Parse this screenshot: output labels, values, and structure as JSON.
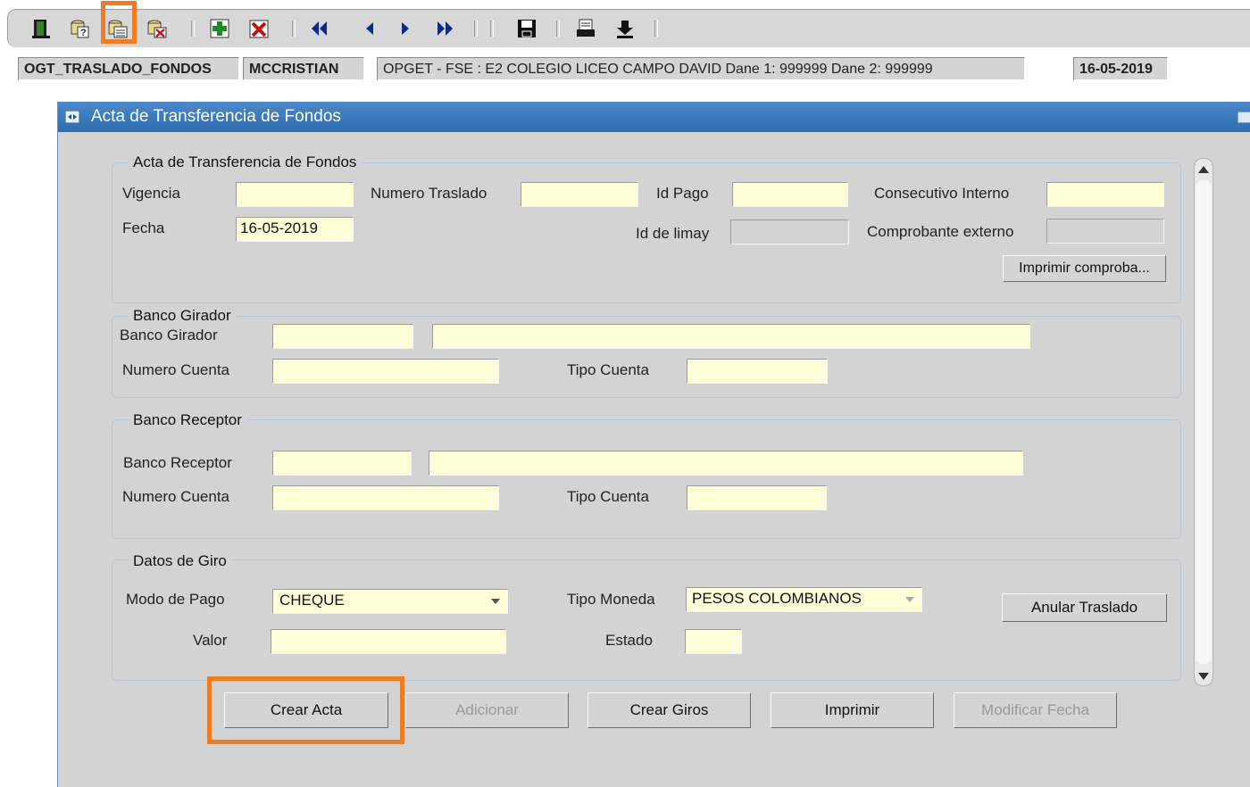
{
  "toolbar": {
    "buttons": [
      {
        "name": "exit-icon"
      },
      {
        "name": "query-icon"
      },
      {
        "name": "execute-query-icon"
      },
      {
        "name": "cancel-query-icon"
      },
      {
        "name": "insert-record-icon"
      },
      {
        "name": "delete-record-icon"
      },
      {
        "name": "first-record-icon"
      },
      {
        "name": "previous-record-icon"
      },
      {
        "name": "next-record-icon"
      },
      {
        "name": "last-record-icon"
      },
      {
        "name": "save-icon"
      },
      {
        "name": "print-icon"
      },
      {
        "name": "download-icon"
      }
    ],
    "highlight_color": "#f07c22"
  },
  "status_bar": {
    "module": "OGT_TRASLADO_FONDOS",
    "user": "MCCRISTIAN",
    "entity": "OPGET - FSE : E2 COLEGIO LICEO CAMPO DAVID  Dane 1: 999999  Dane 2: 999999",
    "date": "16-05-2019"
  },
  "window": {
    "title": "Acta de Transferencia de Fondos",
    "title_bar_color": "#3a78bd"
  },
  "acta": {
    "title": "Acta de Transferencia de Fondos",
    "vigencia_label": "Vigencia",
    "vigencia_value": "",
    "numero_traslado_label": "Numero Traslado",
    "numero_traslado_value": "",
    "id_pago_label": "Id Pago",
    "id_pago_value": "",
    "consecutivo_label": "Consecutivo Interno",
    "consecutivo_value": "",
    "fecha_label": "Fecha",
    "fecha_value": "16-05-2019",
    "id_limay_label": "Id de limay",
    "id_limay_value": "",
    "comprobante_label": "Comprobante externo",
    "comprobante_value": "",
    "imprimir_comprobante_label": "Imprimir comproba..."
  },
  "banco_girador": {
    "title": "Banco Girador",
    "banco_label": "Banco Girador",
    "banco_code": "",
    "banco_name": "",
    "numero_cuenta_label": "Numero Cuenta",
    "numero_cuenta_value": "",
    "tipo_cuenta_label": "Tipo Cuenta",
    "tipo_cuenta_value": ""
  },
  "banco_receptor": {
    "title": "Banco Receptor",
    "banco_label": "Banco Receptor",
    "banco_code": "",
    "banco_name": "",
    "numero_cuenta_label": "Numero Cuenta",
    "numero_cuenta_value": "",
    "tipo_cuenta_label": "Tipo Cuenta",
    "tipo_cuenta_value": ""
  },
  "datos_giro": {
    "title": "Datos de Giro",
    "modo_pago_label": "Modo de Pago",
    "modo_pago_value": "CHEQUE",
    "tipo_moneda_label": "Tipo Moneda",
    "tipo_moneda_value": "PESOS COLOMBIANOS",
    "valor_label": "Valor",
    "valor_value": "",
    "estado_label": "Estado",
    "estado_value": "",
    "anular_label": "Anular Traslado"
  },
  "actions": {
    "crear_acta": "Crear Acta",
    "adicionar": "Adicionar",
    "crear_giros": "Crear Giros",
    "imprimir": "Imprimir",
    "modificar_fecha": "Modificar Fecha"
  }
}
